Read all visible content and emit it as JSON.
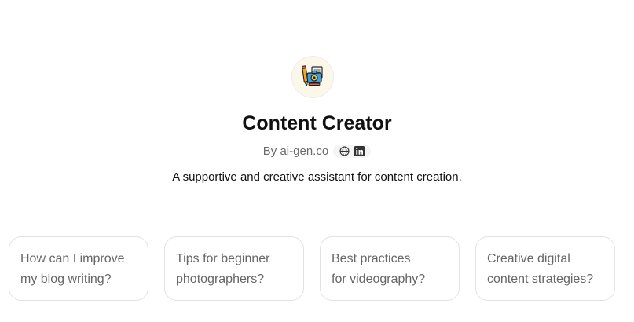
{
  "gpt": {
    "avatar_icon": "content-creator-pencil-camera-icon",
    "title": "Content Creator",
    "by_label": "By ai-gen.co",
    "website_icon": "globe-icon",
    "social_icon": "linkedin-icon",
    "description": "A supportive and creative assistant for content creation."
  },
  "starters": [
    {
      "line1": "How can I improve",
      "line2": "my blog writing?"
    },
    {
      "line1": "Tips for beginner",
      "line2": "photographers?"
    },
    {
      "line1": "Best practices",
      "line2": "for videography?"
    },
    {
      "line1": "Creative digital",
      "line2": "content strategies?"
    }
  ],
  "colors": {
    "text": "#111111",
    "muted": "#6b6b6b",
    "card_border": "#e3e3e3",
    "avatar_bg": "#fbf8ea"
  }
}
